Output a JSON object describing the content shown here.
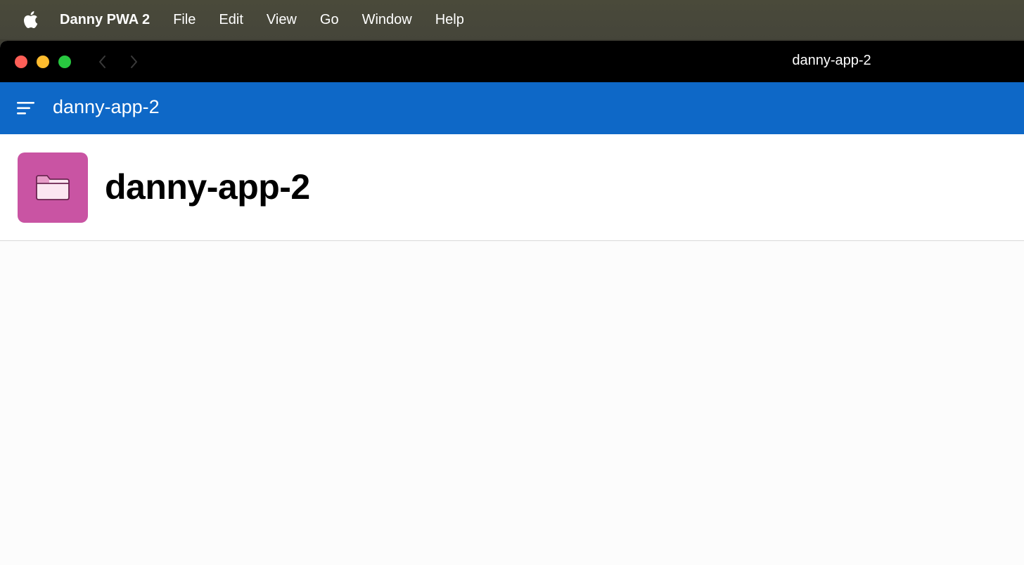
{
  "menubar": {
    "app_name": "Danny PWA 2",
    "items": [
      {
        "label": "File"
      },
      {
        "label": "Edit"
      },
      {
        "label": "View"
      },
      {
        "label": "Go"
      },
      {
        "label": "Window"
      },
      {
        "label": "Help"
      }
    ],
    "icon": "apple-icon"
  },
  "window": {
    "title": "danny-app-2",
    "traffic_lights": {
      "close_color": "#fe5f57",
      "minimize_color": "#febc2e",
      "zoom_color": "#28c840"
    },
    "nav_icons": [
      "chevron-left-icon",
      "chevron-right-icon"
    ]
  },
  "appbar": {
    "title": "danny-app-2",
    "menu_icon": "hamburger-menu-icon",
    "color": "#0e68c7"
  },
  "page": {
    "title": "danny-app-2",
    "icon": "folder-icon",
    "icon_tile_color": "#c954a3"
  }
}
